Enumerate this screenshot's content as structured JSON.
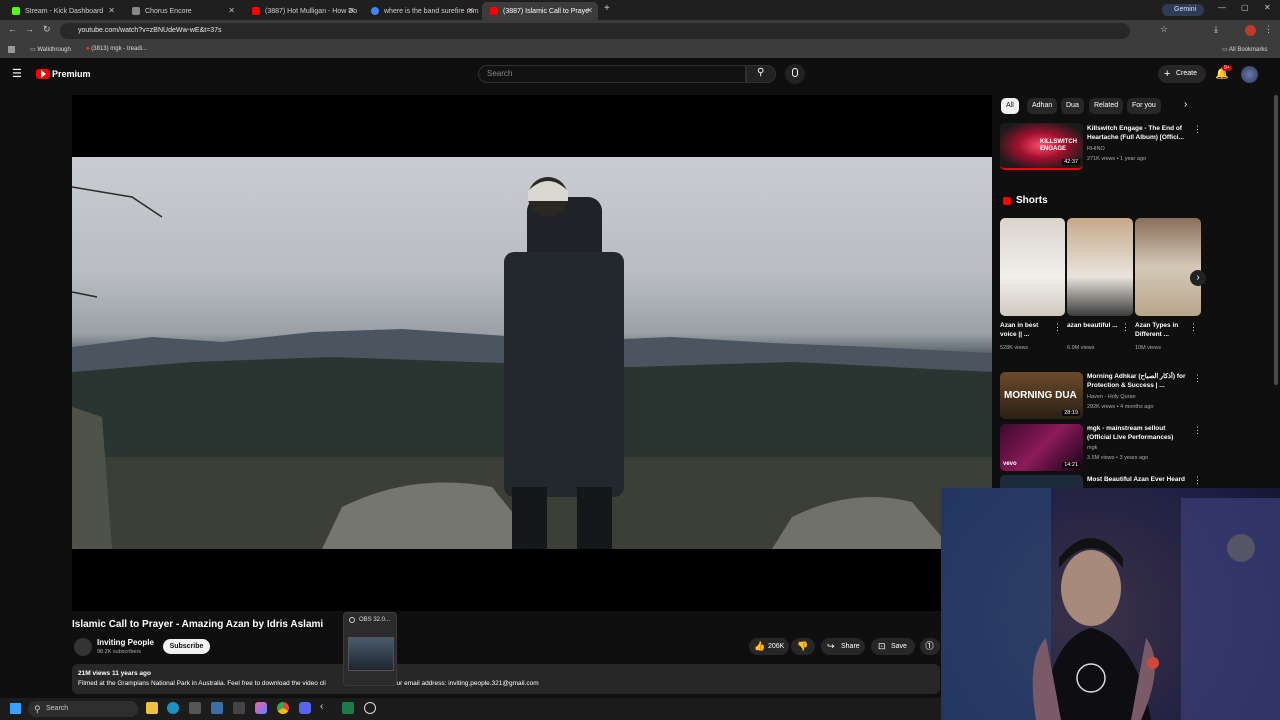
{
  "browser": {
    "tabs": [
      {
        "label": "Stream - Kick Dashboard",
        "color": "#53fc18"
      },
      {
        "label": "Chorus Encore",
        "color": "#888888"
      },
      {
        "label": "(3887) Hot Mulligan - How Do",
        "color": "#ff0000"
      },
      {
        "label": "where is the band surefire rom",
        "color": "#4285f4"
      },
      {
        "label": "(3887) Islamic Call to Praye",
        "color": "#ff0000"
      }
    ],
    "url": "youtube.com/watch?v=zBNUdeWw-wE&t=37s",
    "bookmarks": [
      "Walkthrough",
      "(3813) mgk - treadi..."
    ],
    "all_bookmarks": "All Bookmarks",
    "gemini": "Gemini"
  },
  "youtube": {
    "logo_text": "Premium",
    "search_placeholder": "Search",
    "create_label": "Create",
    "notif_count": "9+",
    "video": {
      "title": "Islamic Call to Prayer - Amazing Azan by Idris Aslami",
      "channel": "Inviting People",
      "subscribers": "98.2K subscribers",
      "subscribe_label": "Subscribe",
      "likes": "206K",
      "share_label": "Share",
      "save_label": "Save",
      "views_age": "21M views  11 years ago",
      "description": "Filmed at the Grampians National Park in Australia. Feel free to download the video cli",
      "description_tail": ". Our email address: inviting.people.321@gmail.com"
    },
    "chips": [
      "All",
      "Adhan",
      "Dua",
      "Related",
      "For you"
    ],
    "recommended": [
      {
        "title": "Killswitch Engage - The End of Heartache (Full Album) [Offici...",
        "channel": "RHINO",
        "meta": "271K views • 1 year ago",
        "duration": "42:37",
        "thumb_text": "KILLSWITCH ENGAGE"
      },
      {
        "title": "Morning Adhkar (أذكار الصباح) for Protection & Success | ...",
        "channel": "Haven - Holy Quran",
        "meta": "292K views • 4 months ago",
        "duration": "28:19",
        "thumb_text": "MORNING DUA"
      },
      {
        "title": "mgk - mainstream sellout (Official Live Performances)",
        "channel": "mgk",
        "meta": "3.5M views • 3 years ago",
        "duration": "14:21",
        "thumb_text": "vevo"
      },
      {
        "title": "Most Beautiful Azan Ever Heard",
        "channel": "",
        "meta": "",
        "duration": "",
        "thumb_text": ""
      }
    ],
    "shorts_heading": "Shorts",
    "shorts": [
      {
        "title": "Azan in best voice || ...",
        "views": "528K views"
      },
      {
        "title": "azan beautiful ...",
        "views": "6.9M views"
      },
      {
        "title": "Azan Types in Different ...",
        "views": "10M views"
      }
    ]
  },
  "taskbar": {
    "search": "Search",
    "obs_label": "OBS 32.0..."
  }
}
